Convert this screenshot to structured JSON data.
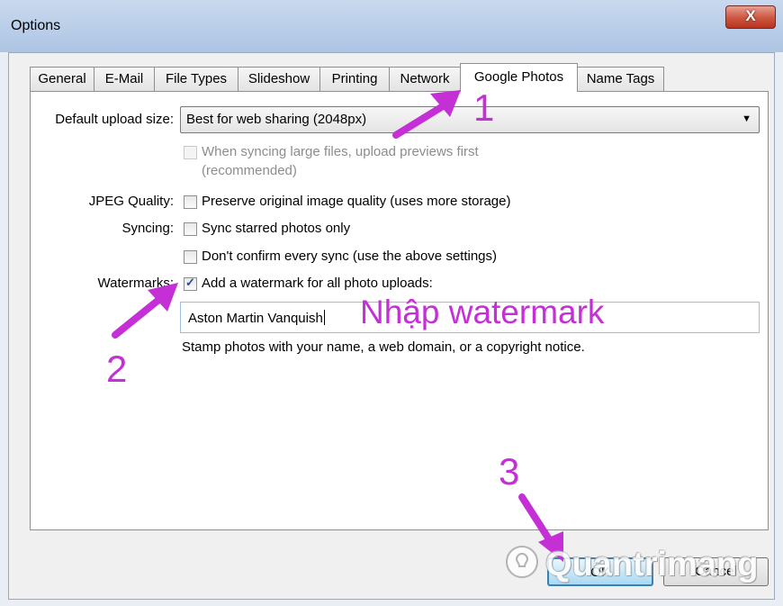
{
  "window": {
    "title": "Options",
    "close_label": "X"
  },
  "tabs": [
    {
      "label": "General"
    },
    {
      "label": "E-Mail"
    },
    {
      "label": "File Types"
    },
    {
      "label": "Slideshow"
    },
    {
      "label": "Printing"
    },
    {
      "label": "Network"
    },
    {
      "label": "Google Photos"
    },
    {
      "label": "Name Tags"
    }
  ],
  "form": {
    "upload_size_label": "Default upload size:",
    "upload_size_value": "Best for web sharing (2048px)",
    "previews_line1": "When syncing large files, upload previews first",
    "previews_line2": "(recommended)",
    "jpeg_label": "JPEG Quality:",
    "jpeg_option": "Preserve original image quality (uses more storage)",
    "syncing_label": "Syncing:",
    "starred_option": "Sync starred photos only",
    "confirm_option": "Don't confirm every sync (use the above settings)",
    "watermarks_label": "Watermarks:",
    "watermark_option": "Add a watermark for all photo uploads:",
    "watermark_value": "Aston Martin Vanquish",
    "help_text": "Stamp photos with your name, a web domain, or a copyright notice."
  },
  "buttons": {
    "ok": "OK",
    "cancel": "Cancel"
  },
  "annotations": {
    "step1": "1",
    "step2": "2",
    "step3": "3",
    "note": "Nhập watermark",
    "color": "#c52fd6"
  },
  "watermark_logo": "Quantrimang"
}
